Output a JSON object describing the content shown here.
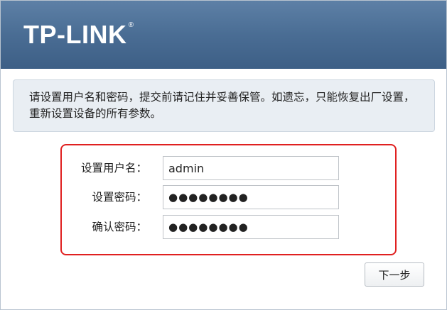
{
  "brand": {
    "name": "TP-LINK",
    "registered_mark": "®",
    "header_color": "#4a6d94"
  },
  "notice": {
    "text": "请设置用户名和密码，提交前请记住并妥善保管。如遗忘，只能恢复出厂设置，重新设置设备的所有参数。"
  },
  "form": {
    "highlight_color": "#e02020",
    "username": {
      "label": "设置用户名：",
      "value": "admin"
    },
    "password": {
      "label": "设置密码：",
      "value": "●●●●●●●●"
    },
    "confirm_password": {
      "label": "确认密码：",
      "value": "●●●●●●●●"
    }
  },
  "actions": {
    "next_label": "下一步"
  }
}
